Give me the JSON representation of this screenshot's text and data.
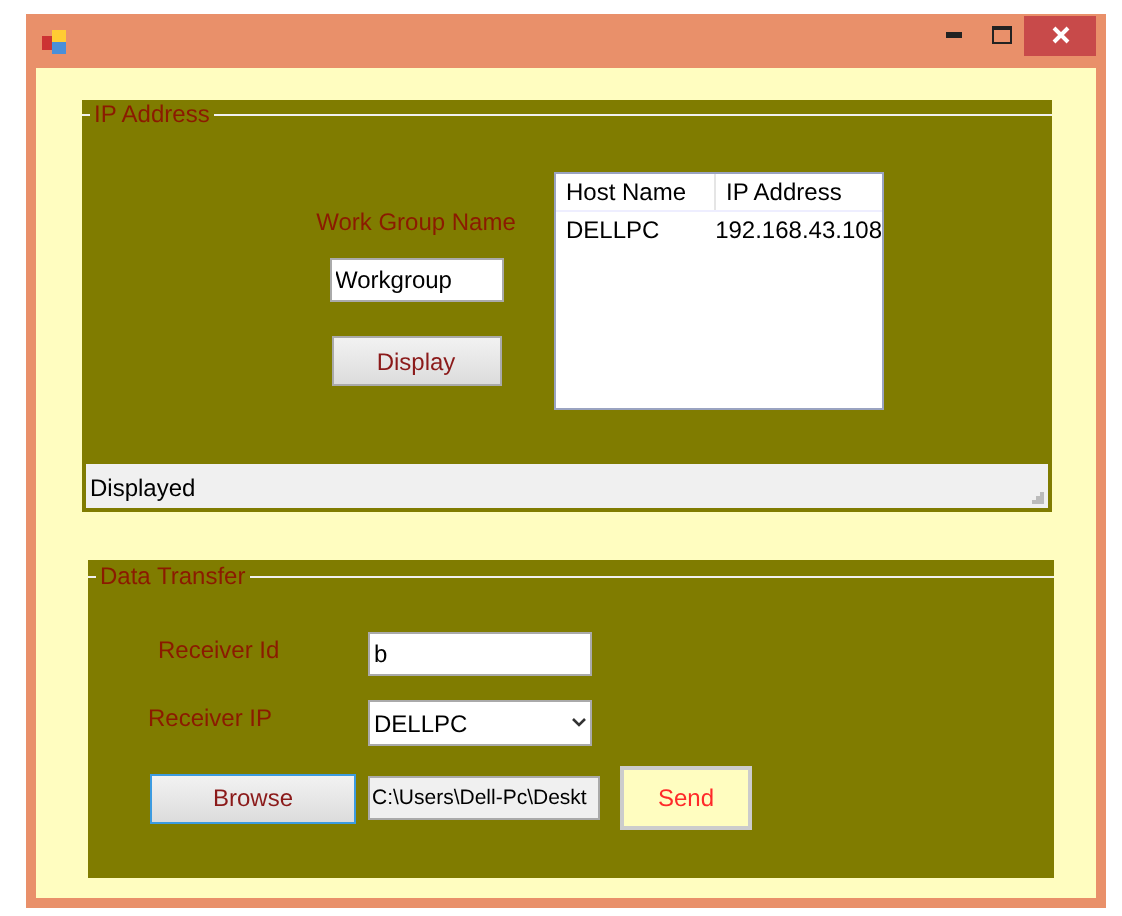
{
  "ip_group": {
    "title": "IP Address",
    "work_group_label": "Work Group Name",
    "work_group_value": "Workgroup",
    "display_button": "Display",
    "list": {
      "columns": [
        "Host Name",
        "IP Address"
      ],
      "rows": [
        [
          "DELLPC",
          "192.168.43.108"
        ]
      ]
    },
    "status": "Displayed"
  },
  "transfer_group": {
    "title": "Data Transfer",
    "receiver_id_label": "Receiver Id",
    "receiver_id_value": "b",
    "receiver_ip_label": "Receiver IP",
    "receiver_ip_value": "DELLPC",
    "browse_button": "Browse",
    "file_path": "C:\\Users\\Dell-Pc\\Deskt",
    "send_button": "Send"
  }
}
